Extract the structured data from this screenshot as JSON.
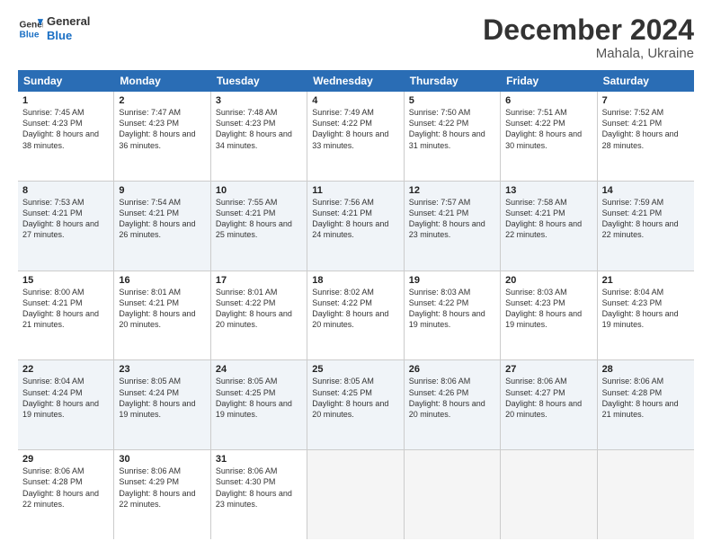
{
  "header": {
    "logo_general": "General",
    "logo_blue": "Blue",
    "month_title": "December 2024",
    "location": "Mahala, Ukraine"
  },
  "days_of_week": [
    "Sunday",
    "Monday",
    "Tuesday",
    "Wednesday",
    "Thursday",
    "Friday",
    "Saturday"
  ],
  "weeks": [
    [
      {
        "day": "1",
        "sunrise": "7:45 AM",
        "sunset": "4:23 PM",
        "daylight": "8 hours and 38 minutes."
      },
      {
        "day": "2",
        "sunrise": "7:47 AM",
        "sunset": "4:23 PM",
        "daylight": "8 hours and 36 minutes."
      },
      {
        "day": "3",
        "sunrise": "7:48 AM",
        "sunset": "4:23 PM",
        "daylight": "8 hours and 34 minutes."
      },
      {
        "day": "4",
        "sunrise": "7:49 AM",
        "sunset": "4:22 PM",
        "daylight": "8 hours and 33 minutes."
      },
      {
        "day": "5",
        "sunrise": "7:50 AM",
        "sunset": "4:22 PM",
        "daylight": "8 hours and 31 minutes."
      },
      {
        "day": "6",
        "sunrise": "7:51 AM",
        "sunset": "4:22 PM",
        "daylight": "8 hours and 30 minutes."
      },
      {
        "day": "7",
        "sunrise": "7:52 AM",
        "sunset": "4:21 PM",
        "daylight": "8 hours and 28 minutes."
      }
    ],
    [
      {
        "day": "8",
        "sunrise": "7:53 AM",
        "sunset": "4:21 PM",
        "daylight": "8 hours and 27 minutes."
      },
      {
        "day": "9",
        "sunrise": "7:54 AM",
        "sunset": "4:21 PM",
        "daylight": "8 hours and 26 minutes."
      },
      {
        "day": "10",
        "sunrise": "7:55 AM",
        "sunset": "4:21 PM",
        "daylight": "8 hours and 25 minutes."
      },
      {
        "day": "11",
        "sunrise": "7:56 AM",
        "sunset": "4:21 PM",
        "daylight": "8 hours and 24 minutes."
      },
      {
        "day": "12",
        "sunrise": "7:57 AM",
        "sunset": "4:21 PM",
        "daylight": "8 hours and 23 minutes."
      },
      {
        "day": "13",
        "sunrise": "7:58 AM",
        "sunset": "4:21 PM",
        "daylight": "8 hours and 22 minutes."
      },
      {
        "day": "14",
        "sunrise": "7:59 AM",
        "sunset": "4:21 PM",
        "daylight": "8 hours and 22 minutes."
      }
    ],
    [
      {
        "day": "15",
        "sunrise": "8:00 AM",
        "sunset": "4:21 PM",
        "daylight": "8 hours and 21 minutes."
      },
      {
        "day": "16",
        "sunrise": "8:01 AM",
        "sunset": "4:21 PM",
        "daylight": "8 hours and 20 minutes."
      },
      {
        "day": "17",
        "sunrise": "8:01 AM",
        "sunset": "4:22 PM",
        "daylight": "8 hours and 20 minutes."
      },
      {
        "day": "18",
        "sunrise": "8:02 AM",
        "sunset": "4:22 PM",
        "daylight": "8 hours and 20 minutes."
      },
      {
        "day": "19",
        "sunrise": "8:03 AM",
        "sunset": "4:22 PM",
        "daylight": "8 hours and 19 minutes."
      },
      {
        "day": "20",
        "sunrise": "8:03 AM",
        "sunset": "4:23 PM",
        "daylight": "8 hours and 19 minutes."
      },
      {
        "day": "21",
        "sunrise": "8:04 AM",
        "sunset": "4:23 PM",
        "daylight": "8 hours and 19 minutes."
      }
    ],
    [
      {
        "day": "22",
        "sunrise": "8:04 AM",
        "sunset": "4:24 PM",
        "daylight": "8 hours and 19 minutes."
      },
      {
        "day": "23",
        "sunrise": "8:05 AM",
        "sunset": "4:24 PM",
        "daylight": "8 hours and 19 minutes."
      },
      {
        "day": "24",
        "sunrise": "8:05 AM",
        "sunset": "4:25 PM",
        "daylight": "8 hours and 19 minutes."
      },
      {
        "day": "25",
        "sunrise": "8:05 AM",
        "sunset": "4:25 PM",
        "daylight": "8 hours and 20 minutes."
      },
      {
        "day": "26",
        "sunrise": "8:06 AM",
        "sunset": "4:26 PM",
        "daylight": "8 hours and 20 minutes."
      },
      {
        "day": "27",
        "sunrise": "8:06 AM",
        "sunset": "4:27 PM",
        "daylight": "8 hours and 20 minutes."
      },
      {
        "day": "28",
        "sunrise": "8:06 AM",
        "sunset": "4:28 PM",
        "daylight": "8 hours and 21 minutes."
      }
    ],
    [
      {
        "day": "29",
        "sunrise": "8:06 AM",
        "sunset": "4:28 PM",
        "daylight": "8 hours and 22 minutes."
      },
      {
        "day": "30",
        "sunrise": "8:06 AM",
        "sunset": "4:29 PM",
        "daylight": "8 hours and 22 minutes."
      },
      {
        "day": "31",
        "sunrise": "8:06 AM",
        "sunset": "4:30 PM",
        "daylight": "8 hours and 23 minutes."
      },
      null,
      null,
      null,
      null
    ]
  ]
}
